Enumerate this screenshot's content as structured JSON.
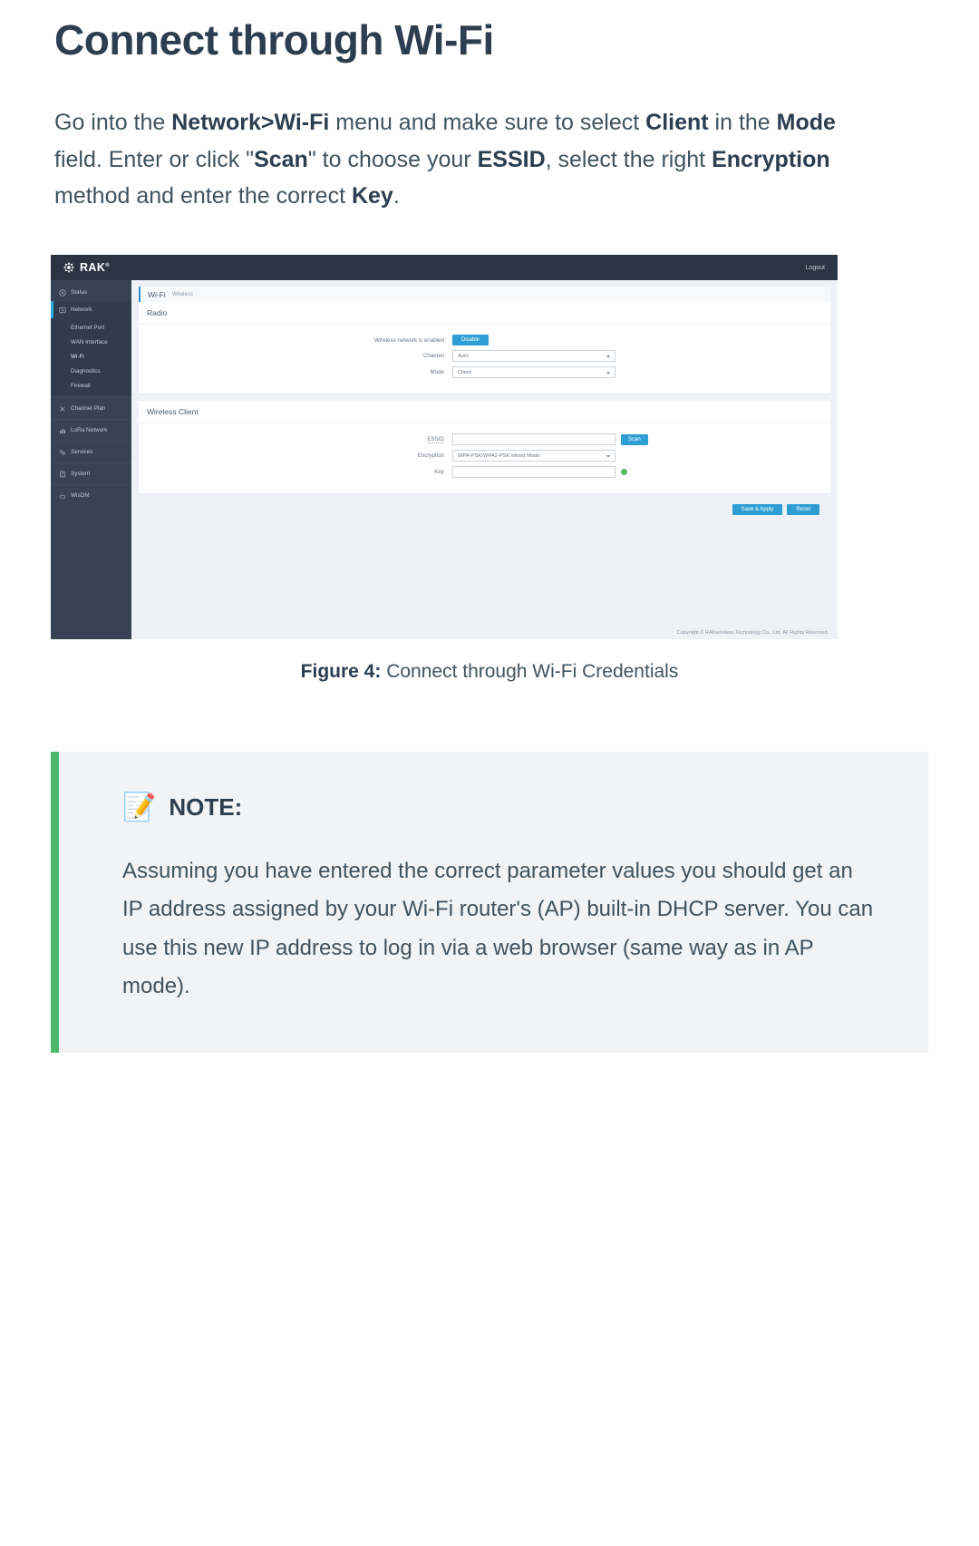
{
  "article": {
    "title": "Connect through Wi-Fi",
    "intro_parts": [
      {
        "t": "Go into the ",
        "b": false
      },
      {
        "t": "Network>Wi-Fi",
        "b": true
      },
      {
        "t": " menu and make sure to select ",
        "b": false
      },
      {
        "t": "Client",
        "b": true
      },
      {
        "t": " in the ",
        "b": false
      },
      {
        "t": "Mode",
        "b": true
      },
      {
        "t": " field. Enter or click \"",
        "b": false
      },
      {
        "t": "Scan",
        "b": true
      },
      {
        "t": "\" to choose your ",
        "b": false
      },
      {
        "t": "ESSID",
        "b": true
      },
      {
        "t": ", select the right ",
        "b": false
      },
      {
        "t": "Encryption",
        "b": true
      },
      {
        "t": " method and enter the correct ",
        "b": false
      },
      {
        "t": "Key",
        "b": true
      },
      {
        "t": ".",
        "b": false
      }
    ]
  },
  "figure": {
    "caption_label": "Figure 4:",
    "caption_text": "Connect through Wi-Fi Credentials"
  },
  "screenshot": {
    "topbar": {
      "brand": "RAK",
      "brand_tm": "®",
      "logout": "Logout"
    },
    "sidebar": {
      "items": [
        {
          "label": "Status",
          "icon": "dashboard-icon",
          "active": false
        },
        {
          "label": "Network",
          "icon": "network-icon",
          "active": true
        },
        {
          "label": "Channel Plan",
          "icon": "channel-plan-icon",
          "active": false
        },
        {
          "label": "LoRa Network",
          "icon": "lora-network-icon",
          "active": false
        },
        {
          "label": "Services",
          "icon": "services-icon",
          "active": false
        },
        {
          "label": "System",
          "icon": "system-icon",
          "active": false
        },
        {
          "label": "WisDM",
          "icon": "wisdm-icon",
          "active": false
        }
      ],
      "subitems": [
        {
          "label": "Ethernet Port",
          "current": false
        },
        {
          "label": "WAN Interface",
          "current": false
        },
        {
          "label": "Wi-Fi",
          "current": true
        },
        {
          "label": "Diagnostics",
          "current": false
        },
        {
          "label": "Firewall",
          "current": false
        }
      ]
    },
    "breadcrumb": {
      "main": "Wi-Fi",
      "sub": "Wireless"
    },
    "radio_card": {
      "title": "Radio",
      "status_label": "Wireless network is enabled",
      "disable_button": "Disable",
      "channel_label": "Channel",
      "channel_value": "Auto",
      "mode_label": "Mode",
      "mode_value": "Client"
    },
    "client_card": {
      "title": "Wireless Client",
      "essid_label": "ESSID",
      "essid_value": "",
      "scan_button": "Scan",
      "encryption_label": "Encryption",
      "encryption_value": "WPA-PSK/WPA2-PSK Mixed Mode",
      "key_label": "Key",
      "key_value": ""
    },
    "actions": {
      "save_label": "Save & Apply",
      "reset_label": "Reset"
    },
    "footer": "Copyright © RAKwireless Technology Co., Ltd. All Rights Reserved.",
    "colors": {
      "sidebar_bg": "#374257",
      "topbar_bg": "#2b3443",
      "accent_blue": "#2f9ed4",
      "panel_bg": "#eef1f5"
    }
  },
  "note": {
    "icon": "memo-icon",
    "title": "NOTE:",
    "body": "Assuming you have entered the correct parameter values you should get an IP address assigned by your Wi-Fi router's (AP) built-in DHCP server. You can use this new IP address to log in via a web browser (same way as in AP mode)."
  }
}
